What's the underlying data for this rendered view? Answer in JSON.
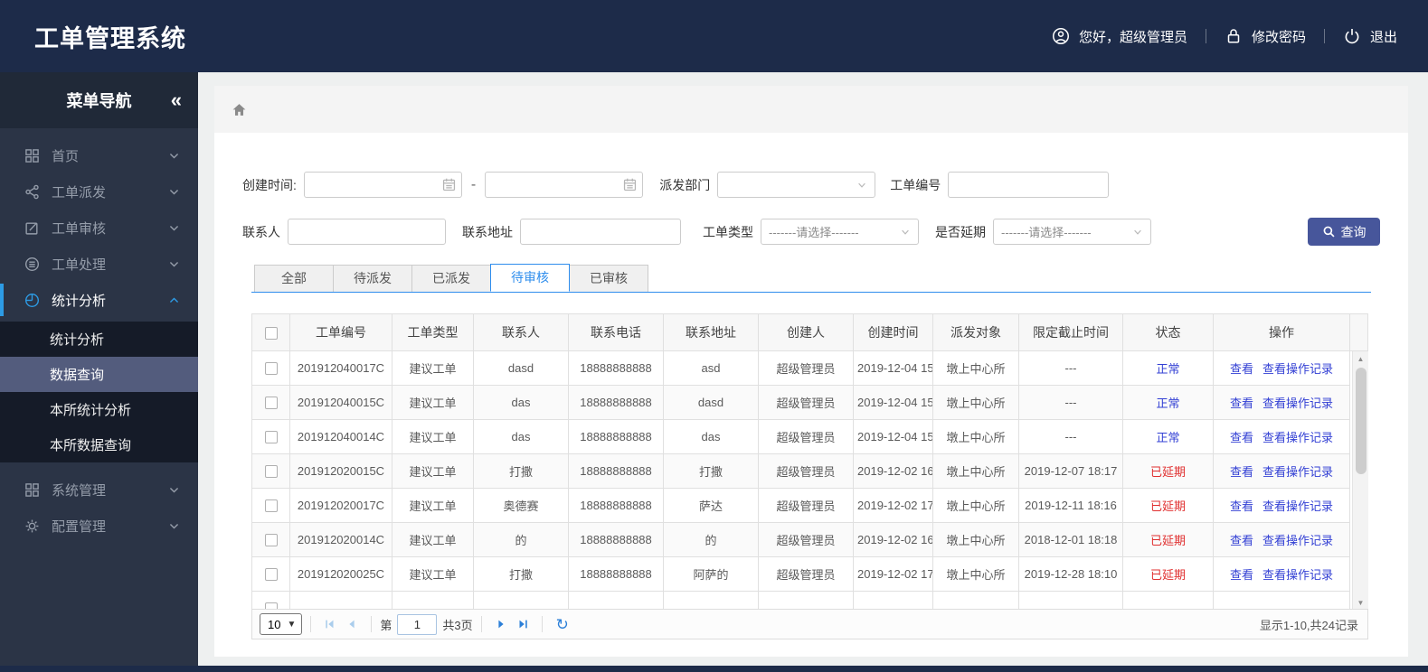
{
  "colors": {
    "header_navy": "#1d2b49",
    "sidebar_dark": "#2b3446",
    "submenu_selected_bg": "#535c7d",
    "accent_blue": "#2e8ded",
    "sidebar_active_blue": "#2d9be5",
    "link_blue": "#3340d4",
    "status_normal_color": "#3340d4",
    "status_delayed_color": "#e02f2f",
    "search_button_navy": "#47569b"
  },
  "header": {
    "title": "工单管理系统",
    "greeting": "您好，超级管理员",
    "change_password": "修改密码",
    "logout": "退出",
    "icons": [
      "user-icon",
      "lock-icon",
      "power-icon"
    ]
  },
  "sidebar": {
    "title": "菜单导航",
    "collapse_icon": "«",
    "items": [
      {
        "label": "首页",
        "icon": "grid-icon"
      },
      {
        "label": "工单派发",
        "icon": "share-icon"
      },
      {
        "label": "工单审核",
        "icon": "edit-icon"
      },
      {
        "label": "工单处理",
        "icon": "database-icon"
      },
      {
        "label": "统计分析",
        "icon": "pie-icon",
        "active": true
      },
      {
        "label": "系统管理",
        "icon": "grid2-icon"
      },
      {
        "label": "配置管理",
        "icon": "gear-icon"
      }
    ],
    "submenu": [
      {
        "label": "统计分析"
      },
      {
        "label": "数据查询",
        "selected": true
      },
      {
        "label": "本所统计分析"
      },
      {
        "label": "本所数据查询"
      }
    ]
  },
  "breadcrumb": {
    "icon": "home-icon"
  },
  "filters": {
    "create_time_label": "创建时间:",
    "range_separator": "-",
    "dispatch_dept_label": "派发部门",
    "order_no_label": "工单编号",
    "contact_label": "联系人",
    "address_label": "联系地址",
    "order_type_label": "工单类型",
    "delay_label": "是否延期",
    "select_placeholder": "-------请选择-------",
    "search_button": "查询"
  },
  "tabs": [
    {
      "label": "全部"
    },
    {
      "label": "待派发"
    },
    {
      "label": "已派发"
    },
    {
      "label": "待审核",
      "active": true
    },
    {
      "label": "已审核"
    }
  ],
  "table": {
    "columns": [
      "工单编号",
      "工单类型",
      "联系人",
      "联系电话",
      "联系地址",
      "创建人",
      "创建时间",
      "派发对象",
      "限定截止时间",
      "状态",
      "操作"
    ],
    "actions": {
      "view": "查看",
      "view_log": "查看操作记录"
    },
    "rows": [
      {
        "order_no": "201912040017C",
        "order_type": "建议工单",
        "contact": "dasd",
        "phone": "18888888888",
        "address": "asd",
        "creator": "超级管理员",
        "create_time": "2019-12-04 15",
        "dispatch_target": "墩上中心所",
        "deadline": "---",
        "status": "正常",
        "status_type": "normal"
      },
      {
        "order_no": "201912040015C",
        "order_type": "建议工单",
        "contact": "das",
        "phone": "18888888888",
        "address": "dasd",
        "creator": "超级管理员",
        "create_time": "2019-12-04 15",
        "dispatch_target": "墩上中心所",
        "deadline": "---",
        "status": "正常",
        "status_type": "normal"
      },
      {
        "order_no": "201912040014C",
        "order_type": "建议工单",
        "contact": "das",
        "phone": "18888888888",
        "address": "das",
        "creator": "超级管理员",
        "create_time": "2019-12-04 15",
        "dispatch_target": "墩上中心所",
        "deadline": "---",
        "status": "正常",
        "status_type": "normal"
      },
      {
        "order_no": "201912020015C",
        "order_type": "建议工单",
        "contact": "打撒",
        "phone": "18888888888",
        "address": "打撒",
        "creator": "超级管理员",
        "create_time": "2019-12-02 16",
        "dispatch_target": "墩上中心所",
        "deadline": "2019-12-07 18:17",
        "status": "已延期",
        "status_type": "delayed"
      },
      {
        "order_no": "201912020017C",
        "order_type": "建议工单",
        "contact": "奥德赛",
        "phone": "18888888888",
        "address": "萨达",
        "creator": "超级管理员",
        "create_time": "2019-12-02 17",
        "dispatch_target": "墩上中心所",
        "deadline": "2019-12-11 18:16",
        "status": "已延期",
        "status_type": "delayed"
      },
      {
        "order_no": "201912020014C",
        "order_type": "建议工单",
        "contact": "的",
        "phone": "18888888888",
        "address": "的",
        "creator": "超级管理员",
        "create_time": "2019-12-02 16",
        "dispatch_target": "墩上中心所",
        "deadline": "2018-12-01 18:18",
        "status": "已延期",
        "status_type": "delayed"
      },
      {
        "order_no": "201912020025C",
        "order_type": "建议工单",
        "contact": "打撒",
        "phone": "18888888888",
        "address": "阿萨的",
        "creator": "超级管理员",
        "create_time": "2019-12-02 17",
        "dispatch_target": "墩上中心所",
        "deadline": "2019-12-28 18:10",
        "status": "已延期",
        "status_type": "delayed"
      }
    ]
  },
  "pagination": {
    "page_size": "10",
    "page_prefix": "第",
    "current_page": "1",
    "total_pages": "共3页",
    "summary": "显示1-10,共24记录"
  }
}
